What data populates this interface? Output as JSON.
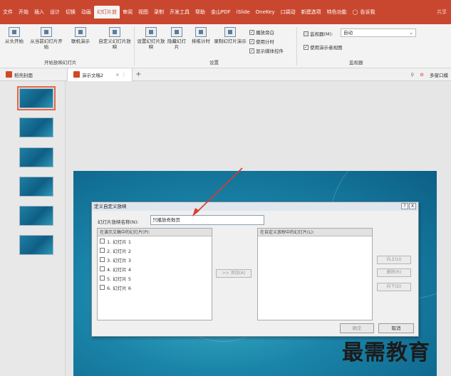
{
  "ribbon_tabs": [
    {
      "label": "文件",
      "active": false
    },
    {
      "label": "开始",
      "active": false
    },
    {
      "label": "插入",
      "active": false
    },
    {
      "label": "设计",
      "active": false
    },
    {
      "label": "切换",
      "active": false
    },
    {
      "label": "动画",
      "active": false
    },
    {
      "label": "幻灯片放",
      "active": true
    },
    {
      "label": "审阅",
      "active": false
    },
    {
      "label": "视图",
      "active": false
    },
    {
      "label": "录制",
      "active": false
    },
    {
      "label": "开发工具",
      "active": false
    },
    {
      "label": "帮助",
      "active": false
    },
    {
      "label": "金山PDF",
      "active": false
    },
    {
      "label": "iSlide",
      "active": false
    },
    {
      "label": "OneKey",
      "active": false
    },
    {
      "label": "口袋动",
      "active": false
    },
    {
      "label": "新建选项",
      "active": false
    },
    {
      "label": "特色功能",
      "active": false
    }
  ],
  "tell_me": "告诉我",
  "share": "共享",
  "ribbon": {
    "from_start": "从头开始",
    "from_current": "从当前幻灯片开始",
    "online": "联机演示",
    "custom": "自定义幻灯片放映",
    "group_start": "开始放映幻灯片",
    "setup": "设置幻灯片放映",
    "hide": "隐藏幻灯片",
    "rehearse": "排练计时",
    "record": "录制幻灯片演示",
    "play_narration": "播放旁白",
    "use_timings": "使用计时",
    "show_media": "显示媒体控件",
    "group_setup": "设置",
    "monitor_label": "监视器(M):",
    "monitor_value": "自动",
    "presenter_view": "使用演示者视图",
    "group_monitor": "监视器"
  },
  "doc_tabs": [
    {
      "label": "稻壳封面",
      "active": false
    },
    {
      "label": "演示文稿2",
      "active": true
    }
  ],
  "doc_right": "多窗口模",
  "dialog": {
    "title": "定义自定义放映",
    "help": "?",
    "close": "X",
    "name_label": "幻灯片放映名称(N):",
    "name_value": "只播放奇数页",
    "left_header": "在演示文稿中的幻灯片(P):",
    "right_header": "在自定义放映中的幻灯片(L):",
    "slides": [
      "1. 幻灯片 1",
      "2. 幻灯片 2",
      "3. 幻灯片 3",
      "4. 幻灯片 4",
      "5. 幻灯片 5",
      "6. 幻灯片 6"
    ],
    "add_btn": ">> 添加(A)",
    "up_btn": "向上(U)",
    "delete_btn": "删除(R)",
    "down_btn": "向下(D)",
    "ok_btn": "确定",
    "cancel_btn": "取消"
  },
  "watermark": "最需教育",
  "colors": {
    "accent": "#c9472f",
    "slide": "#1a84a8"
  }
}
